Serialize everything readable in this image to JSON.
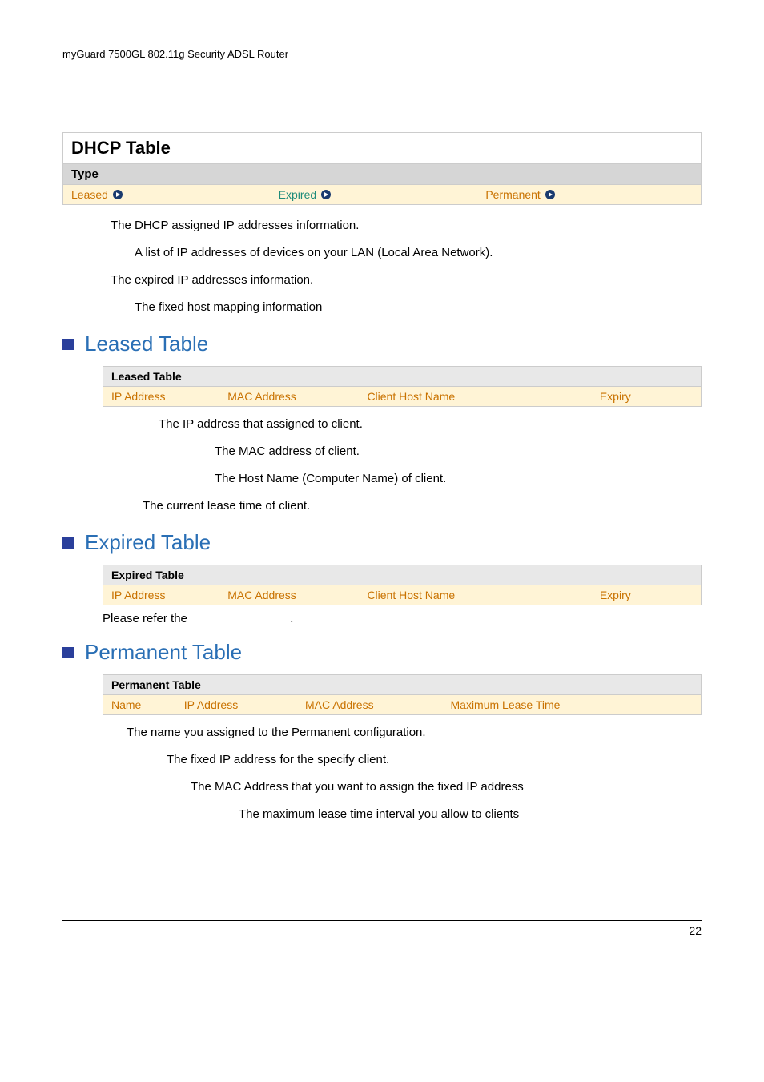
{
  "doc_header": "myGuard 7500GL 802.11g Security ADSL Router",
  "dhcp_table": {
    "title": "DHCP Table",
    "type_label": "Type",
    "types": {
      "leased": "Leased",
      "expired": "Expired",
      "permanent": "Permanent"
    }
  },
  "paragraphs": {
    "p1": "The DHCP assigned IP addresses information.",
    "p2": "A list of IP addresses of devices on your LAN (Local Area Network).",
    "p3": "The expired IP addresses information.",
    "p4": "The fixed host mapping information"
  },
  "leased_section": {
    "heading": "Leased Table",
    "table_title": "Leased Table",
    "cols": {
      "ip": "IP Address",
      "mac": "MAC Address",
      "host": "Client Host Name",
      "expiry": "Expiry"
    },
    "desc": {
      "d1": "The IP address that assigned to client.",
      "d2": "The MAC address of client.",
      "d3": "The Host Name (Computer Name) of client.",
      "d4": "The current lease time of client."
    }
  },
  "expired_section": {
    "heading": "Expired Table",
    "table_title": "Expired Table",
    "cols": {
      "ip": "IP Address",
      "mac": "MAC Address",
      "host": "Client Host Name",
      "expiry": "Expiry"
    },
    "refer": "Please refer the",
    "refer_dot": "."
  },
  "permanent_section": {
    "heading": "Permanent Table",
    "table_title": "Permanent Table",
    "cols": {
      "name": "Name",
      "ip": "IP Address",
      "mac": "MAC Address",
      "max": "Maximum Lease Time"
    },
    "desc": {
      "d1": "The name you assigned to the Permanent configuration.",
      "d2": "The fixed IP address for the specify client.",
      "d3": "The MAC Address that you want to assign the fixed IP address",
      "d4": "The maximum lease time interval you allow to clients"
    }
  },
  "page_number": "22"
}
